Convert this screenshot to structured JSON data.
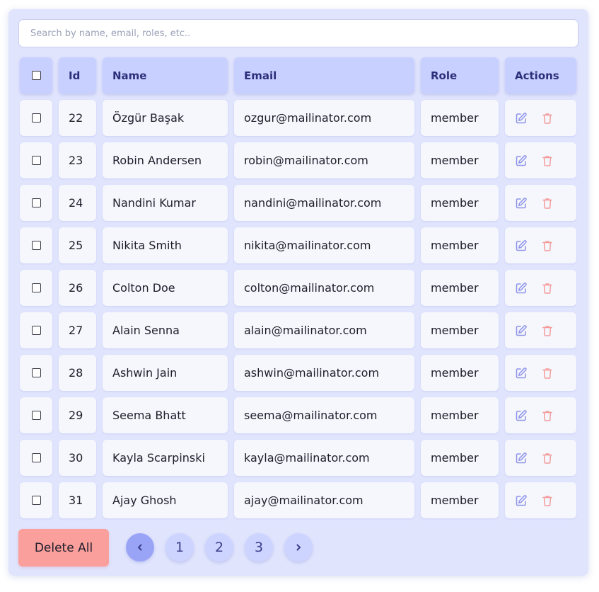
{
  "search": {
    "placeholder": "Search by name, email, roles, etc.."
  },
  "table": {
    "headers": {
      "id": "Id",
      "name": "Name",
      "email": "Email",
      "role": "Role",
      "actions": "Actions"
    },
    "rows": [
      {
        "id": "22",
        "name": "Özgür Başak",
        "email": "ozgur@mailinator.com",
        "role": "member"
      },
      {
        "id": "23",
        "name": "Robin Andersen",
        "email": "robin@mailinator.com",
        "role": "member"
      },
      {
        "id": "24",
        "name": "Nandini Kumar",
        "email": "nandini@mailinator.com",
        "role": "member"
      },
      {
        "id": "25",
        "name": "Nikita Smith",
        "email": "nikita@mailinator.com",
        "role": "member"
      },
      {
        "id": "26",
        "name": "Colton Doe",
        "email": "colton@mailinator.com",
        "role": "member"
      },
      {
        "id": "27",
        "name": "Alain Senna",
        "email": "alain@mailinator.com",
        "role": "member"
      },
      {
        "id": "28",
        "name": "Ashwin Jain",
        "email": "ashwin@mailinator.com",
        "role": "member"
      },
      {
        "id": "29",
        "name": "Seema Bhatt",
        "email": "seema@mailinator.com",
        "role": "member"
      },
      {
        "id": "30",
        "name": "Kayla Scarpinski",
        "email": "kayla@mailinator.com",
        "role": "member"
      },
      {
        "id": "31",
        "name": "Ajay Ghosh",
        "email": "ajay@mailinator.com",
        "role": "member"
      }
    ]
  },
  "icons": {
    "edit": "edit-icon",
    "delete": "trash-icon",
    "prev": "chevron-left-icon",
    "next": "chevron-right-icon"
  },
  "colors": {
    "edit_icon": "#8d93ea",
    "delete_icon": "#f49c9c",
    "accent": "#c8d0ff",
    "delete_all": "#fb9f9d"
  },
  "footer": {
    "delete_all_label": "Delete All",
    "pages": [
      "1",
      "2",
      "3"
    ]
  }
}
